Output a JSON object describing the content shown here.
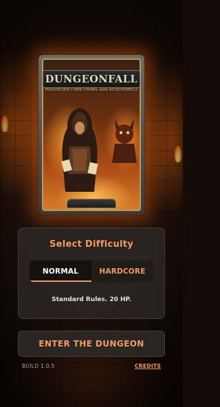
{
  "card": {
    "title": "DUNGEONFALL",
    "subtitle": "ROGUELIKE CARD CRAWL with SCOUNDRELS",
    "illustration": "hooded-rogue-with-cards-and-fire-demon"
  },
  "difficulty": {
    "heading": "Select Difficulty",
    "tabs": [
      {
        "label": "NORMAL",
        "selected": true
      },
      {
        "label": "HARDCORE",
        "selected": false
      }
    ],
    "description": "Standard Rules. 20 HP."
  },
  "actions": {
    "enter_label": "ENTER THE DUNGEON"
  },
  "footer": {
    "build": "BUILD 1.0.5",
    "credits": "CREDITS"
  },
  "colors": {
    "accent": "#f29b61",
    "panel": "#2a2624",
    "background": "#150b07"
  }
}
